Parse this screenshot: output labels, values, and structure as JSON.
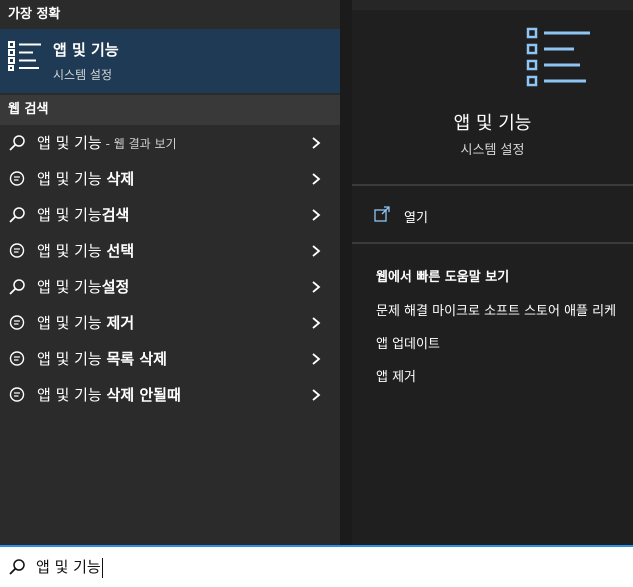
{
  "colors": {
    "accent": "#2f8fe5",
    "selected_bg": "#1e3a54",
    "icon_blue": "#8ec5f4"
  },
  "left": {
    "best_match_header": "가장 정확",
    "best_match": {
      "icon": "apps-list-icon",
      "title": "앱 및 기능",
      "subtitle": "시스템 설정"
    },
    "web_search_header": "웹 검색",
    "web_items": [
      {
        "icon": "search-icon",
        "prefix": "앱 및 기능",
        "suffix": "",
        "hint": " - 웹 결과 보기"
      },
      {
        "icon": "chat-bubble-icon",
        "prefix": "앱 및 기능 ",
        "suffix": "삭제",
        "hint": ""
      },
      {
        "icon": "search-icon",
        "prefix": "앱 및 기능",
        "suffix": "검색",
        "hint": ""
      },
      {
        "icon": "chat-bubble-icon",
        "prefix": "앱 및 기능 ",
        "suffix": "선택",
        "hint": ""
      },
      {
        "icon": "search-icon",
        "prefix": "앱 및 기능",
        "suffix": "설정",
        "hint": ""
      },
      {
        "icon": "chat-bubble-icon",
        "prefix": "앱 및 기능 ",
        "suffix": "제거",
        "hint": ""
      },
      {
        "icon": "chat-bubble-icon",
        "prefix": "앱 및 기능 ",
        "suffix": "목록 삭제",
        "hint": ""
      },
      {
        "icon": "chat-bubble-icon",
        "prefix": "앱 및 기능 ",
        "suffix": "삭제 안될때",
        "hint": ""
      }
    ]
  },
  "preview": {
    "icon": "apps-list-icon",
    "title": "앱 및 기능",
    "subtitle": "시스템 설정",
    "open_label": "열기",
    "quick_help_header": "웹에서 빠른 도움말 보기",
    "quick_links": [
      "문제 해결 마이크로 소프트 스토어 애플 리케",
      "앱 업데이트",
      "앱 제거"
    ]
  },
  "search": {
    "icon": "search-icon",
    "query": "앱 및 기능"
  }
}
